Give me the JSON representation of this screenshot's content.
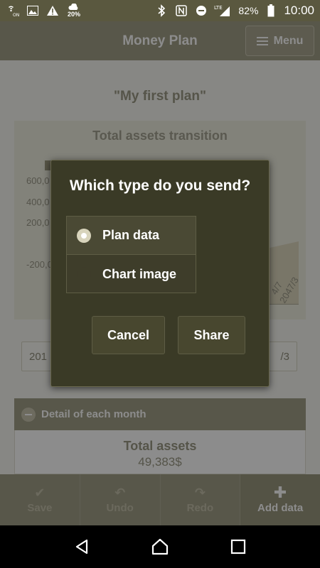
{
  "status_bar": {
    "time": "10:00",
    "battery": "82%",
    "network": "LTE",
    "weather_badge": "20%",
    "icons": [
      "wifi-calling-icon",
      "image-icon",
      "warning-icon",
      "weather-icon",
      "bluetooth-icon",
      "nfc-icon",
      "do-not-disturb-icon",
      "signal-icon",
      "battery-icon"
    ]
  },
  "app_bar": {
    "title": "Money Plan",
    "menu_label": "Menu"
  },
  "plan": {
    "name": "\"My first plan\""
  },
  "chart": {
    "title": "Total assets transition",
    "y_ticks": [
      "600,0",
      "400,0",
      "200,0",
      "-200,0"
    ],
    "x_ticks_visible": [
      "4/7",
      "2047/3"
    ]
  },
  "date_range": {
    "start_partial": "201",
    "end_partial": "/3"
  },
  "detail": {
    "header": "Detail of each month",
    "total_label": "Total assets",
    "total_value": "49,383$"
  },
  "toolbar": {
    "save": "Save",
    "undo": "Undo",
    "redo": "Redo",
    "add": "Add data"
  },
  "dialog": {
    "title": "Which type do you send?",
    "options": [
      "Plan data",
      "Chart image"
    ],
    "selected_option": "Plan data",
    "cancel": "Cancel",
    "share": "Share"
  },
  "colors": {
    "accent": "#a19e87",
    "dialog_bg": "#3a3a26",
    "status_bar": "#5a583f"
  }
}
